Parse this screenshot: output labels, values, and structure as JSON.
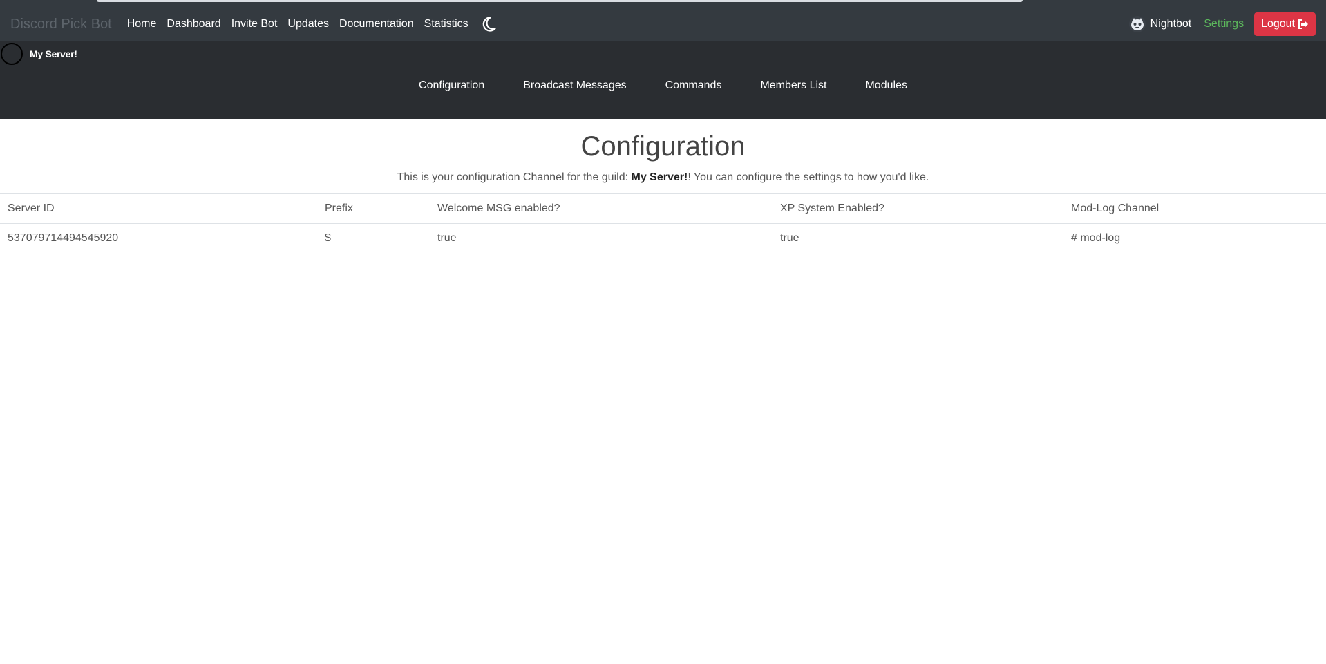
{
  "navbar": {
    "brand": "Discord Pick Bot",
    "links": [
      "Home",
      "Dashboard",
      "Invite Bot",
      "Updates",
      "Documentation",
      "Statistics"
    ],
    "theme_toggle_icon": "moon-icon",
    "user": {
      "name": "Nightbot",
      "avatar_icon": "bot-avatar-icon"
    },
    "settings_label": "Settings",
    "logout_label": "Logout",
    "logout_icon": "sign-out-icon"
  },
  "server": {
    "name": "My Server!"
  },
  "tabs": [
    "Configuration",
    "Broadcast Messages",
    "Commands",
    "Members List",
    "Modules"
  ],
  "page": {
    "title": "Configuration",
    "desc_before": "This is your configuration Channel for the guild: ",
    "desc_guild": "My Server!",
    "desc_after": "! You can configure the settings to how you'd like."
  },
  "table": {
    "headers": [
      "Server ID",
      "Prefix",
      "Welcome MSG enabled?",
      "XP System Enabled?",
      "Mod-Log Channel"
    ],
    "rows": [
      [
        "537079714494545920",
        "$",
        "true",
        "true",
        "# mod-log"
      ]
    ]
  },
  "colors": {
    "navbar_bg": "#343a40",
    "subheader_bg": "#2a2d31",
    "settings_green": "#5cb85c",
    "logout_red": "#dc3545"
  }
}
